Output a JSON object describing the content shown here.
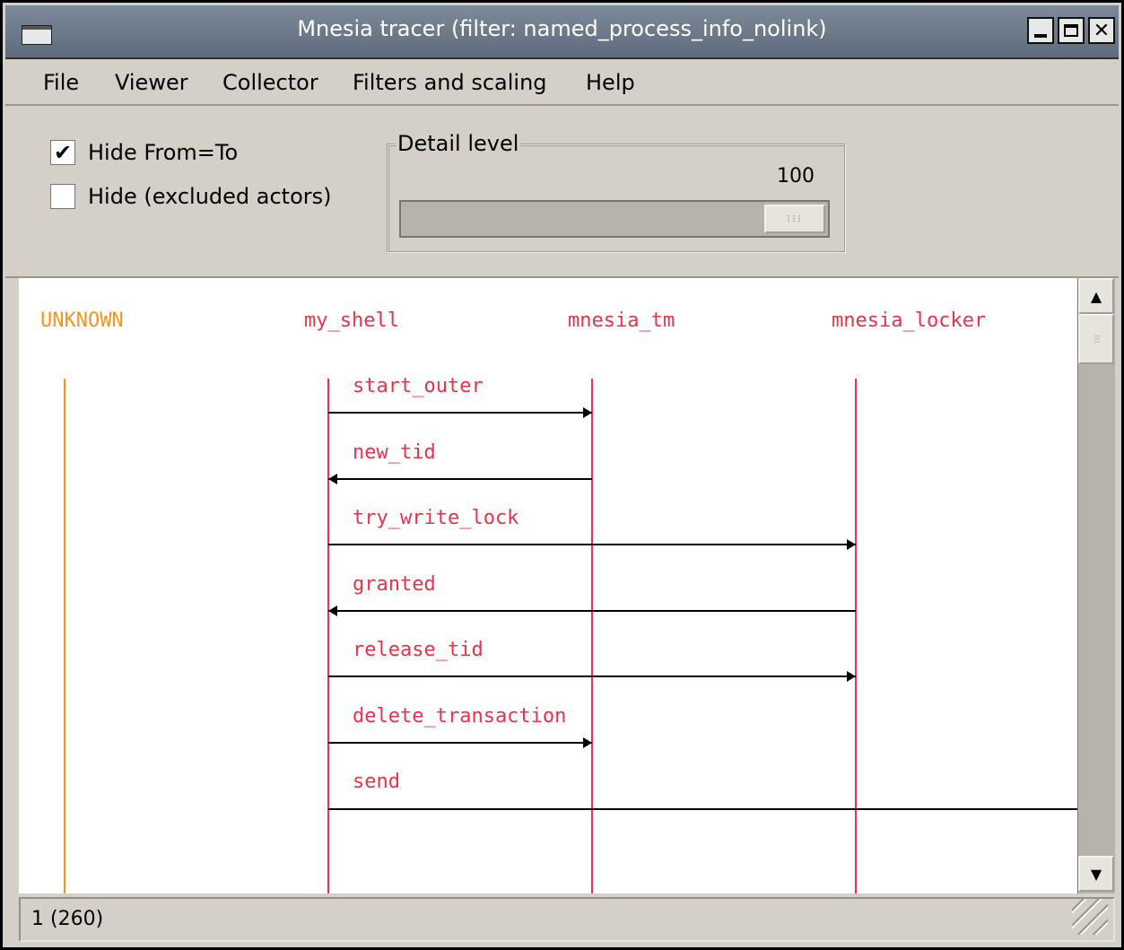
{
  "window": {
    "title": "Mnesia tracer (filter: named_process_info_nolink)",
    "controls": {
      "minimize_icon": "minimize-icon",
      "maximize_icon": "maximize-icon",
      "close_icon": "close-icon",
      "close_glyph": "✕"
    }
  },
  "menu": {
    "items": [
      "File",
      "Viewer",
      "Collector",
      "Filters and scaling",
      "Help"
    ]
  },
  "options": {
    "hide_from_to": {
      "label": "Hide From=To",
      "checked": true,
      "mark": "✔"
    },
    "hide_excluded": {
      "label": "Hide (excluded actors)",
      "checked": false
    },
    "detail_level": {
      "legend": "Detail level",
      "value": "100",
      "slider_fraction": 1.0,
      "thumb_grip": "⁝⁝⁝"
    }
  },
  "sequence": {
    "actors": [
      {
        "name": "UNKNOWN",
        "color": "#f5951f"
      },
      {
        "name": "my_shell",
        "color": "#e8344a"
      },
      {
        "name": "mnesia_tm",
        "color": "#e8344a"
      },
      {
        "name": "mnesia_locker",
        "color": "#e8344a"
      }
    ],
    "messages": [
      {
        "label": "start_outer",
        "from": 1,
        "to": 2
      },
      {
        "label": "new_tid",
        "from": 2,
        "to": 1
      },
      {
        "label": "try_write_lock",
        "from": 1,
        "to": 3
      },
      {
        "label": "granted",
        "from": 3,
        "to": 1
      },
      {
        "label": "release_tid",
        "from": 1,
        "to": 3
      },
      {
        "label": "delete_transaction",
        "from": 1,
        "to": 2
      },
      {
        "label": "send",
        "from": 1,
        "to": "offscreen"
      }
    ]
  },
  "scrollbar": {
    "up_icon": "▲",
    "down_icon": "▼",
    "thumb_grip": "⁝⁝⁝"
  },
  "status": {
    "text": "1 (260)"
  }
}
